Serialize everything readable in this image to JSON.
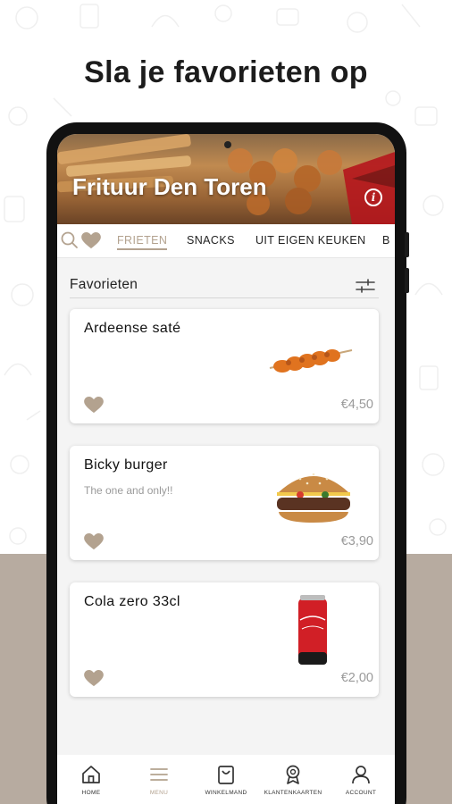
{
  "headline": "Sla je favorieten op",
  "restaurant": {
    "name": "Frituur Den Toren",
    "info_icon": "i"
  },
  "tabs": {
    "search_icon": "search-icon",
    "favorites_icon": "heart-icon",
    "items": [
      "FRIETEN",
      "SNACKS",
      "UIT EIGEN KEUKEN",
      "B"
    ],
    "active_index": 0
  },
  "section": {
    "title": "Favorieten",
    "filter_icon": "sliders-icon"
  },
  "products": [
    {
      "name": "Ardeense saté",
      "description": "",
      "price": "€4,50",
      "image": "sate-skewer-image"
    },
    {
      "name": "Bicky burger",
      "description": "The one and only!!",
      "price": "€3,90",
      "image": "burger-image"
    },
    {
      "name": "Cola zero 33cl",
      "description": "",
      "price": "€2,00",
      "image": "cola-can-image"
    }
  ],
  "bottom_nav": [
    {
      "label": "HOME",
      "icon": "home-icon"
    },
    {
      "label": "MENU",
      "icon": "menu-icon",
      "active": true
    },
    {
      "label": "WINKELMAND",
      "icon": "shopping-bag-icon"
    },
    {
      "label": "KLANTENKAARTEN",
      "icon": "award-ribbon-icon"
    },
    {
      "label": "ACCOUNT",
      "icon": "user-icon"
    }
  ],
  "colors": {
    "accent": "#b3a28f",
    "lower_background": "#b7aba0",
    "heart": "#b3a28f",
    "price_text": "#9a9a9a"
  }
}
